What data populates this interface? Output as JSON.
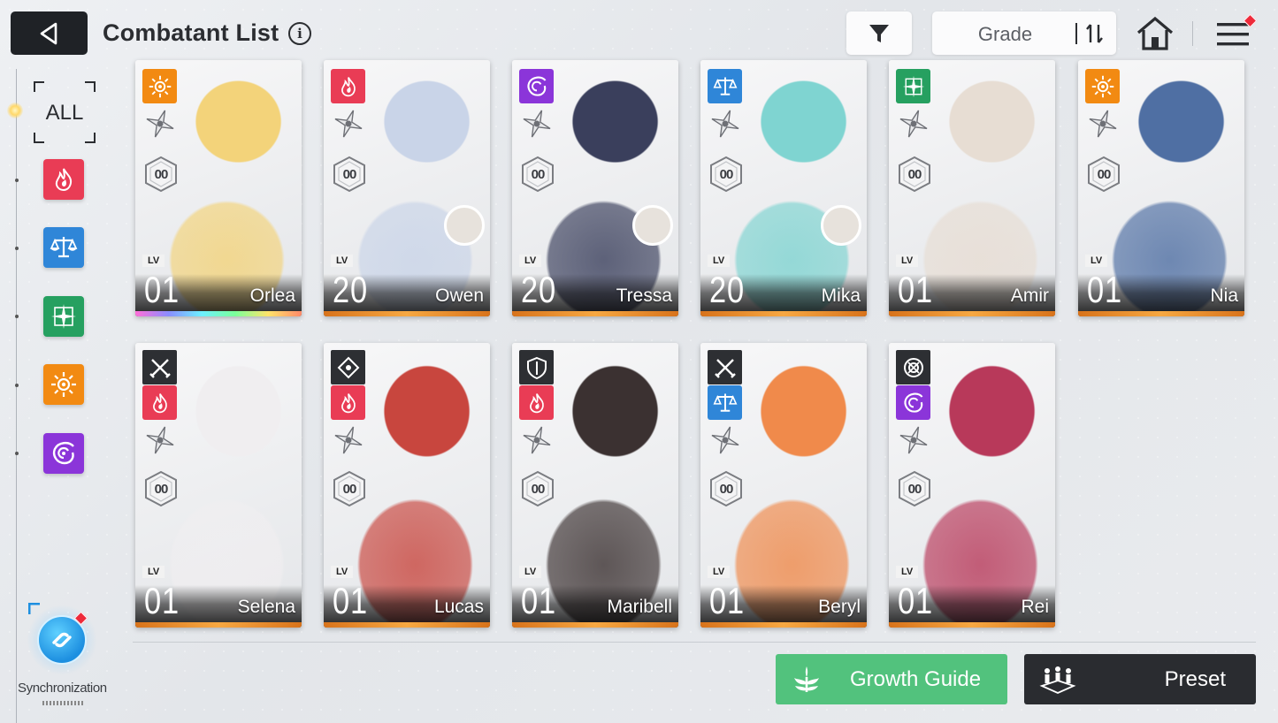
{
  "header": {
    "title": "Combatant List",
    "info_icon": "i",
    "sort_label": "Grade"
  },
  "filters": {
    "all_label": "ALL",
    "classes": [
      {
        "name": "flame",
        "color": "#e93c55"
      },
      {
        "name": "balance",
        "color": "#2f86d8"
      },
      {
        "name": "star-cross",
        "color": "#26a060"
      },
      {
        "name": "sun",
        "color": "#f28a12"
      },
      {
        "name": "vortex",
        "color": "#8b35d9"
      }
    ]
  },
  "sync": {
    "label": "Synchronization"
  },
  "level_tag": "LV",
  "combatants": [
    {
      "name": "Orlea",
      "level": "01",
      "grade": "00",
      "class": "sun",
      "stripe": "rainbow",
      "avatar": false,
      "new": false,
      "role": null
    },
    {
      "name": "Owen",
      "level": "20",
      "grade": "00",
      "class": "flame",
      "stripe": "orange",
      "avatar": true,
      "new": false,
      "role": null
    },
    {
      "name": "Tressa",
      "level": "20",
      "grade": "00",
      "class": "vortex",
      "stripe": "orange",
      "avatar": true,
      "new": false,
      "role": null
    },
    {
      "name": "Mika",
      "level": "20",
      "grade": "00",
      "class": "balance",
      "stripe": "orange",
      "avatar": true,
      "new": false,
      "role": null
    },
    {
      "name": "Amir",
      "level": "01",
      "grade": "00",
      "class": "star-cross",
      "stripe": "orange",
      "avatar": false,
      "new": false,
      "role": null
    },
    {
      "name": "Nia",
      "level": "01",
      "grade": "00",
      "class": "sun",
      "stripe": "orange",
      "avatar": false,
      "new": false,
      "role": null
    },
    {
      "name": "Selena",
      "level": "01",
      "grade": "00",
      "class": "flame",
      "stripe": "orange",
      "avatar": false,
      "new": true,
      "role": "crossed-blades"
    },
    {
      "name": "Lucas",
      "level": "01",
      "grade": "00",
      "class": "flame",
      "stripe": "orange",
      "avatar": false,
      "new": true,
      "role": "crosshair"
    },
    {
      "name": "Maribell",
      "level": "01",
      "grade": "00",
      "class": "flame",
      "stripe": "orange",
      "avatar": false,
      "new": true,
      "role": "shield"
    },
    {
      "name": "Beryl",
      "level": "01",
      "grade": "00",
      "class": "balance",
      "stripe": "orange",
      "avatar": false,
      "new": true,
      "role": "crossed-blades"
    },
    {
      "name": "Rei",
      "level": "01",
      "grade": "00",
      "class": "vortex",
      "stripe": "orange",
      "avatar": false,
      "new": true,
      "role": "target"
    }
  ],
  "actions": {
    "growth_guide": "Growth Guide",
    "preset": "Preset"
  },
  "colors": {
    "card_art": [
      "#f3d37a",
      "#c9d4e8",
      "#3a3f5c",
      "#7fd4d1",
      "#e7ddd3",
      "#4f6fa3",
      "#f0eef0",
      "#c8463e",
      "#3b3131",
      "#f08a4b",
      "#b8395a"
    ]
  }
}
